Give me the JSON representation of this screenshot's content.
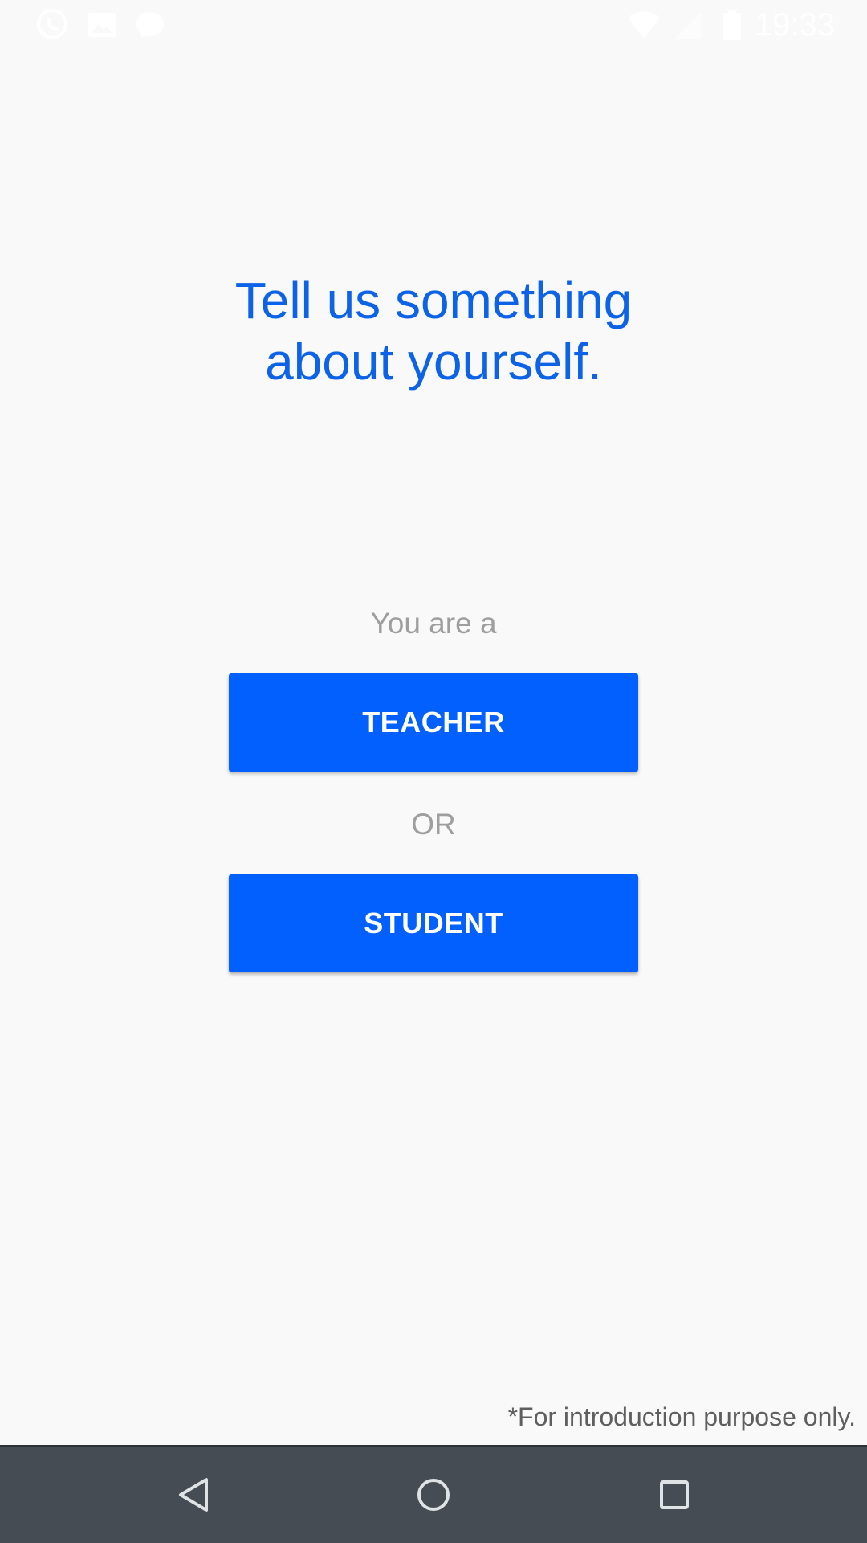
{
  "status_bar": {
    "time": "19:33",
    "notification_icons": [
      "whatsapp-icon",
      "gallery-icon",
      "messenger-icon"
    ],
    "system_icons": [
      "wifi-icon",
      "signal-icon",
      "battery-icon"
    ]
  },
  "main": {
    "title_line1": "Tell us something",
    "title_line2": "about yourself.",
    "prompt": "You are a",
    "teacher_label": "TEACHER",
    "or_label": "OR",
    "student_label": "STUDENT",
    "footnote": "*For introduction purpose only."
  },
  "nav_bar": {
    "icons": [
      "back-icon",
      "home-icon",
      "recents-icon"
    ]
  },
  "colors": {
    "accent": "#0261fe",
    "title": "#0c63e7",
    "background": "#f9f9f9",
    "nav_background": "#464c53",
    "muted_text": "#9e9e9e"
  }
}
